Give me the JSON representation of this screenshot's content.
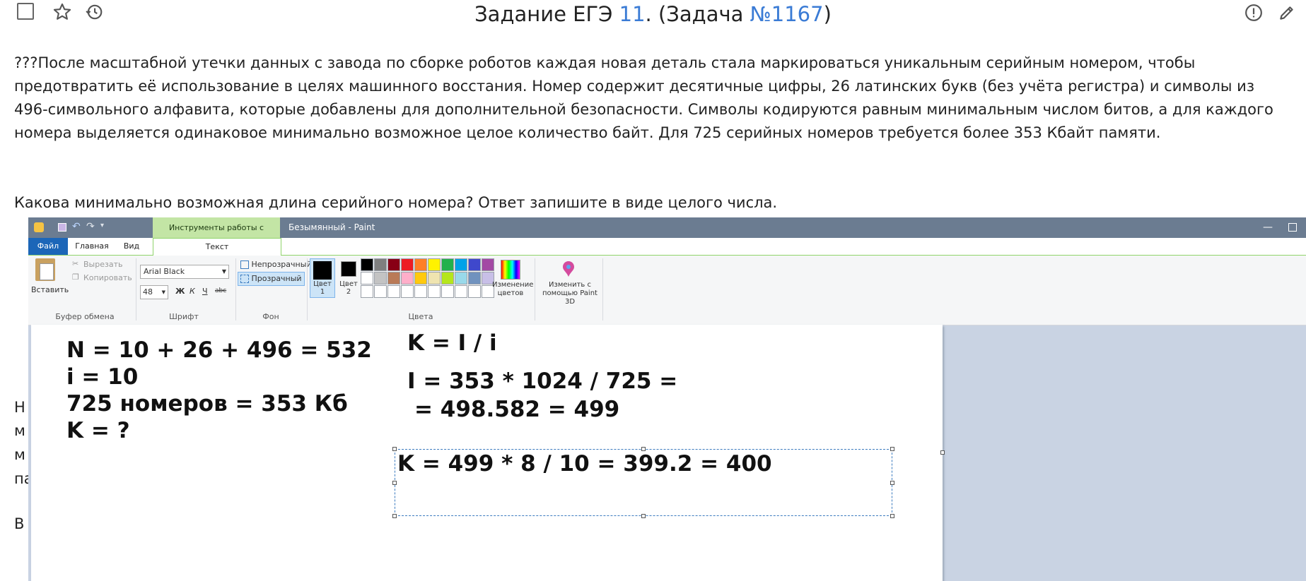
{
  "header": {
    "title_prefix": "Задание ЕГЭ ",
    "title_num": "11",
    "title_mid": ". (Задача ",
    "task_link": "№1167",
    "title_end": ")"
  },
  "task": {
    "paragraph": "???После масштабной утечки данных с завода по сборке роботов каждая новая деталь стала маркироваться уникальным серийным номером, чтобы предотвратить её использование в целях машинного восстания. Номер содержит десятичные цифры, 26 латинских букв (без учёта регистра) и символы из 496-символьного алфавита, которые добавлены для дополнительной безопасности. Символы кодируются равным минимальным числом битов, а для каждого номера выделяется одинаковое минимально возможное целое количество байт. Для 725 серийных номеров требуется более 353 Кбайт памяти.",
    "question": "Какова минимально возможная длина серийного номера? Ответ запишите в виде целого числа."
  },
  "background_fragments": [
    "Н",
    "м",
    "м",
    "па",
    "В"
  ],
  "paint": {
    "context_tab": "Инструменты работы с текстом",
    "window_title": "Безымянный - Paint",
    "tabs": {
      "file": "Файл",
      "home": "Главная",
      "view": "Вид",
      "text": "Текст"
    },
    "clipboard": {
      "paste": "Вставить",
      "cut": "Вырезать",
      "copy": "Копировать",
      "group": "Буфер обмена"
    },
    "font": {
      "name": "Arial Black",
      "size": "48",
      "bold": "Ж",
      "italic": "К",
      "underline": "Ч",
      "strike": "abc",
      "group": "Шрифт"
    },
    "background": {
      "opaque": "Непрозрачный",
      "transparent": "Прозрачный",
      "group": "Фон"
    },
    "colors": {
      "color1": "Цвет 1",
      "color2": "Цвет 2",
      "edit": "Изменение цветов",
      "paint3d": "Изменить с помощью Paint 3D",
      "group": "Цвета",
      "row1": [
        "#000000",
        "#7f7f7f",
        "#880015",
        "#ed1c24",
        "#ff7f27",
        "#fff200",
        "#22b14c",
        "#00a2e8",
        "#3f48cc",
        "#a349a4"
      ],
      "row2": [
        "#ffffff",
        "#c3c3c3",
        "#b97a57",
        "#ffaec9",
        "#ffc90e",
        "#efe4b0",
        "#b5e61d",
        "#99d9ea",
        "#7092be",
        "#c8bfe7"
      ]
    },
    "canvas": {
      "left_lines": [
        "N = 10 + 26 + 496 = 532",
        "i = 10",
        "725 номеров = 353 Кб",
        "K = ?"
      ],
      "right_lines": [
        "K = I / i",
        "I = 353 * 1024 / 725 =",
        "= 498.582 = 499"
      ],
      "selected_line": "K = 499 * 8 / 10 = 399.2 = 400"
    }
  }
}
